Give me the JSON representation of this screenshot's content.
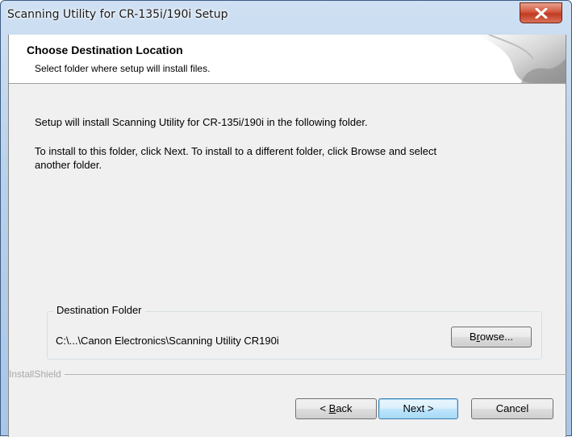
{
  "window": {
    "title": "Scanning Utility for CR-135i/190i Setup"
  },
  "banner": {
    "title": "Choose Destination Location",
    "subtitle": "Select folder where setup will install files."
  },
  "body": {
    "line1": "Setup will install Scanning Utility for CR-135i/190i in the following folder.",
    "line2a": "To install to this folder, click Next. To install to a different folder, click Browse and select",
    "line2b": "another folder."
  },
  "destination": {
    "group_label": "Destination Folder",
    "path": "C:\\...\\Canon Electronics\\Scanning Utility CR190i",
    "browse_pre": "B",
    "browse_accel": "r",
    "browse_post": "owse..."
  },
  "footer": {
    "brand": "InstallShield",
    "back_pre": "< ",
    "back_accel": "B",
    "back_post": "ack",
    "next_label": "Next >",
    "cancel_label": "Cancel"
  },
  "icons": {
    "close": "close-icon",
    "banner_graphic": "installshield-banner-graphic"
  }
}
